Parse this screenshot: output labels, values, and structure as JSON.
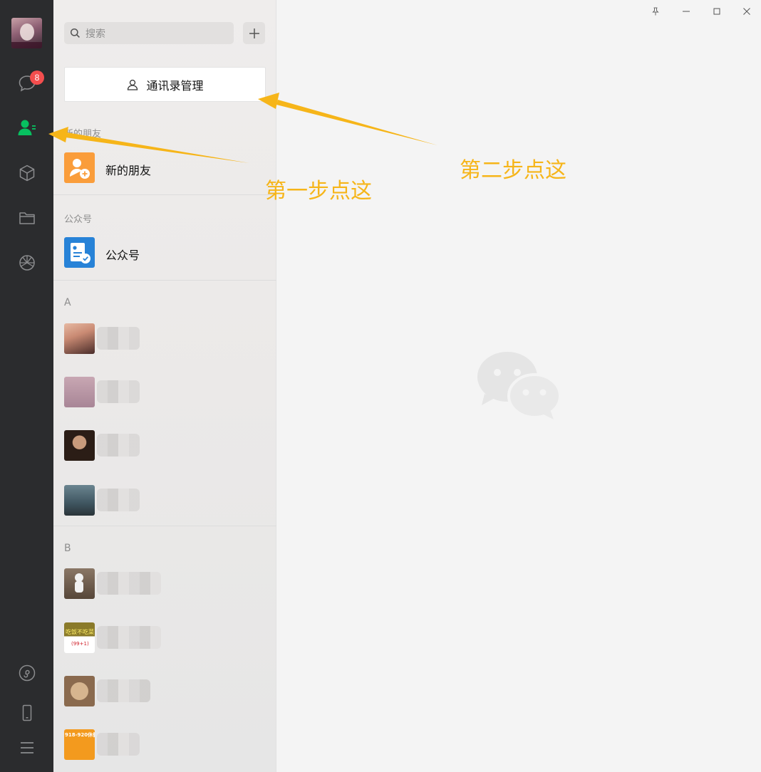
{
  "rail": {
    "avatar": "user-avatar",
    "unread_badge": "8",
    "items": [
      "chat-icon",
      "contacts-icon",
      "favorites-cube-icon",
      "files-folder-icon",
      "moments-icon",
      "mini-programs-icon",
      "phone-icon",
      "menu-icon"
    ],
    "active_color": "#07c160"
  },
  "panel": {
    "search_placeholder": "搜索",
    "manage_contacts_label": "通讯录管理",
    "sections": {
      "new_friends_title": "新的朋友",
      "new_friends_item": "新的朋友",
      "official_title": "公众号",
      "official_item": "公众号",
      "group_a": "A",
      "group_b": "B"
    },
    "contacts_a": [
      "",
      "",
      "",
      ""
    ],
    "contacts_b": [
      "",
      "",
      "",
      ""
    ],
    "avatar_texts": {
      "b2_top": "吃饭不吃菜",
      "b2_badge": "(99+1)",
      "b4_top": "918-920休假"
    }
  },
  "window": {
    "buttons": [
      "pin-icon",
      "minimize-icon",
      "maximize-icon",
      "close-icon"
    ]
  },
  "annotations": {
    "step1": "第一步点这",
    "step2": "第二步点这",
    "color": "#f6b519"
  }
}
